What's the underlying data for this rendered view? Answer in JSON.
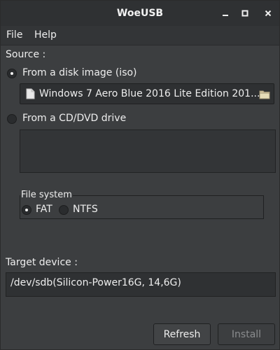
{
  "window": {
    "title": "WoeUSB",
    "controls": [
      "minimize-icon",
      "maximize-icon",
      "close-icon"
    ]
  },
  "menu": {
    "file": "File",
    "help": "Help"
  },
  "source": {
    "label": "Source :",
    "disk_image_option": "From a disk image (iso)",
    "disk_image_selected": true,
    "file_path": "Windows 7 Aero Blue 2016 Lite Edition 201...",
    "file_icon": "document-icon",
    "browse_icon": "folder-icon",
    "cd_option": "From a CD/DVD drive",
    "cd_selected": false
  },
  "filesystem": {
    "label": "File system",
    "fat_label": "FAT",
    "fat_selected": true,
    "ntfs_label": "NTFS",
    "ntfs_selected": false
  },
  "target": {
    "label": "Target device :",
    "device": "/dev/sdb(Silicon-Power16G, 14,6G)"
  },
  "buttons": {
    "refresh": "Refresh",
    "install": "Install"
  },
  "colors": {
    "background": "#3c3e40",
    "titlebar": "#2f3133",
    "text": "#eeeeee",
    "disabled_text": "#8a8c8e"
  }
}
